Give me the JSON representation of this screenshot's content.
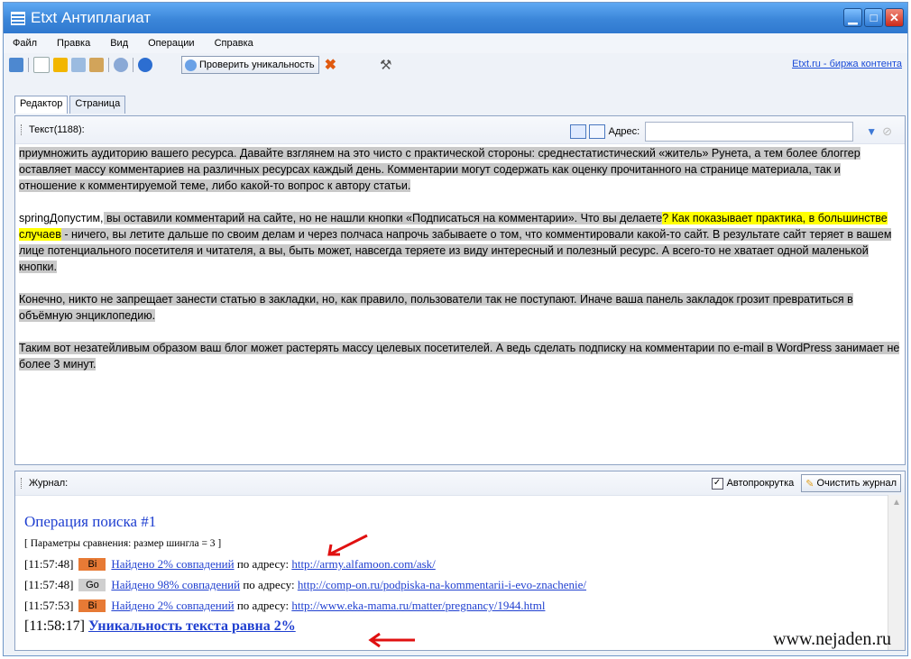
{
  "window": {
    "title": "Etxt Антиплагиат"
  },
  "menu": [
    "Файл",
    "Правка",
    "Вид",
    "Операции",
    "Справка"
  ],
  "toolbar": {
    "check_label": "Проверить уникальность",
    "site_link": "Etxt.ru - биржа контента"
  },
  "tabs": [
    "Редактор",
    "Страница"
  ],
  "editor": {
    "text_count_label": "Текст(1188):",
    "address_label": "Адрес:",
    "address_value": ""
  },
  "text": {
    "p1": "приумножить аудиторию вашего ресурса. Давайте взглянем на это чисто с практической стороны: среднестатистический «житель» Рунета, а тем более блоггер оставляет массу комментариев на различных ресурсах каждый день. Комментарии могут содержать как оценку прочитанного на странице материала, так и отношение к комментируемой теме, либо какой-то вопрос к автору статьи.",
    "p2_a": "springДопустим,",
    "p2_b": " вы оставили комментарий на сайте, но не нашли кнопки «Подписаться на комментарии». Что вы делаете",
    "p2_c": "? Как показывает практика, в большинстве случаев",
    "p2_d": " - ничего, вы летите дальше по своим делам и через полчаса напрочь забываете о том, что комментировали какой-то сайт. В результате сайт теряет в вашем лице потенциального посетителя и читателя, а вы, быть может, навсегда теряете из виду интересный и полезный ресурс. А всего-то не хватает одной маленькой кнопки.",
    "p3": "Конечно, никто не запрещает занести статью в закладки, но, как правило, пользователи так не поступают. Иначе ваша панель закладок грозит превратиться в объёмную энциклопедию.",
    "p4": "Таким вот незатейливым образом ваш блог может растерять массу целевых посетителей. А ведь сделать подписку на комментарии по e-mail в WordPress занимает не более 3 минут."
  },
  "journal": {
    "label": "Журнал:",
    "autoscroll_label": "Автопрокрутка",
    "autoscroll_checked": true,
    "clear_label": "Очистить журнал",
    "op_title": "Операция поиска #1",
    "params": "[ Параметры сравнения: размер шингла = 3 ]",
    "entries": [
      {
        "time": "[11:57:48]",
        "badge": "Bi",
        "match": "Найдено 2% совпадений",
        "mid": " по адресу: ",
        "url": "http://army.alfamoon.com/ask/"
      },
      {
        "time": "[11:57:48]",
        "badge": "Go",
        "match": "Найдено 98% совпадений",
        "mid": " по адресу: ",
        "url": "http://comp-on.ru/podpiska-na-kommentarii-i-evo-znachenie/"
      },
      {
        "time": "[11:57:53]",
        "badge": "Bi",
        "match": "Найдено 2% совпадений",
        "mid": " по адресу: ",
        "url": "http://www.eka-mama.ru/matter/pregnancy/1944.html"
      }
    ],
    "final_time": "[11:58:17]",
    "final_text": "Уникальность текста равна 2%"
  },
  "watermark": "www.nejaden.ru",
  "colors": {
    "accent": "#3b86d9",
    "arrow": "#e01010",
    "highlight_gray": "#c9c9c9",
    "highlight_yellow": "#ffff00"
  }
}
